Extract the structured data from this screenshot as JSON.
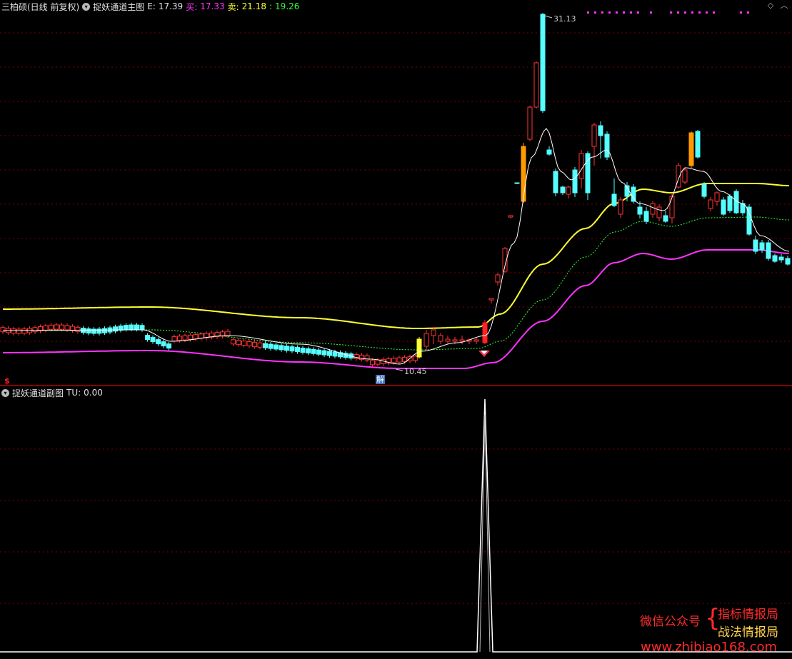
{
  "main": {
    "title": "三柏硕(日线 前复权)",
    "indicator_name": "捉妖通道主图",
    "values": [
      {
        "label": "E:",
        "value": "17.39",
        "color": "#e0e0e0"
      },
      {
        "label": "买:",
        "value": "17.33",
        "color": "#ff33ff"
      },
      {
        "label": "卖:",
        "value": "21.18",
        "color": "#ffff33"
      },
      {
        "label": ":",
        "value": "19.26",
        "color": "#33ff33"
      }
    ],
    "high_label": "31.13",
    "low_label": "10.45",
    "jie_label": "解",
    "s_label": "$"
  },
  "sub": {
    "indicator_name": "捉妖通道副图",
    "value_label": "TU:",
    "value": "0.00"
  },
  "watermark": {
    "left_text": "微信公众号",
    "brace": "{",
    "line1": "指标情报局",
    "line2": "战法情报局",
    "url": "www.zhibiao168.com"
  },
  "colors": {
    "up": "#ff3333",
    "down": "#55ffff",
    "grid": "#7a0000",
    "yellow_line": "#ffff33",
    "magenta_line": "#ff33ff",
    "green_line": "#33ff33",
    "ma_line": "#ffffff"
  }
}
